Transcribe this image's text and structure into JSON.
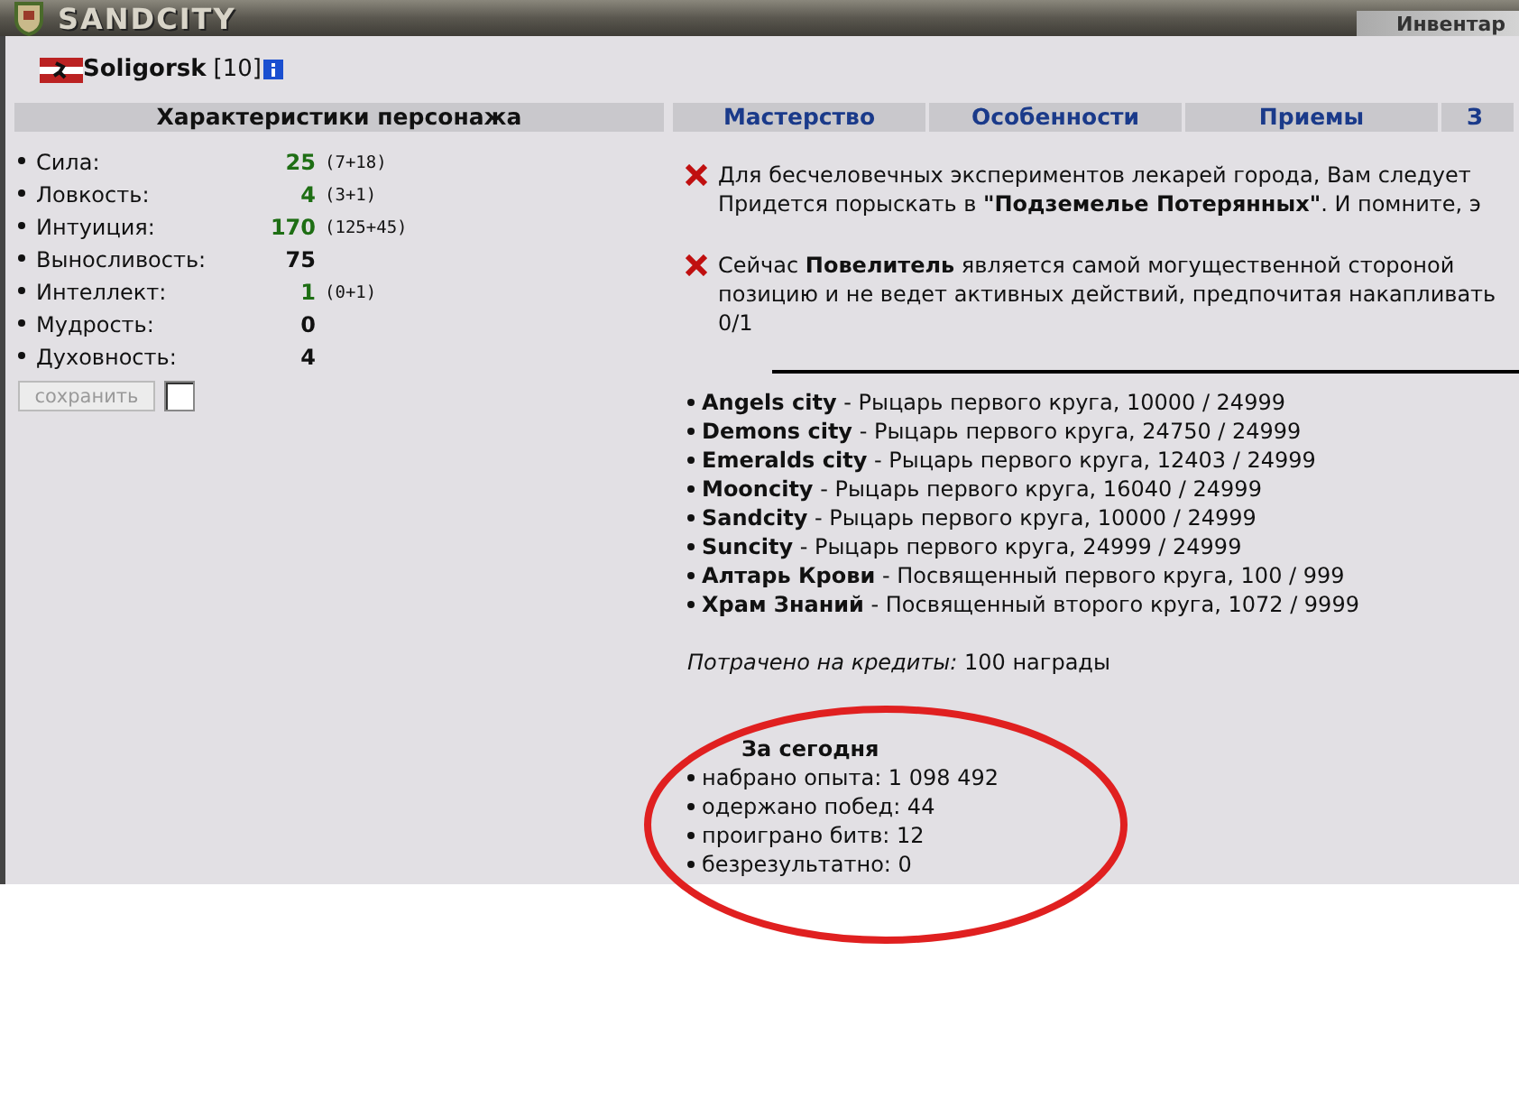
{
  "top_bar": {
    "logo": "SANDCITY",
    "button": "Инвентар"
  },
  "character": {
    "name": "Soligorsk",
    "level": "[10]"
  },
  "stats_panel": {
    "title": "Характеристики персонажа",
    "stats": [
      {
        "label": "Сила:",
        "value": "25",
        "bonus": "(7+18)",
        "boosted": true
      },
      {
        "label": "Ловкость:",
        "value": "4",
        "bonus": "(3+1)",
        "boosted": true
      },
      {
        "label": "Интуиция:",
        "value": "170",
        "bonus": "(125+45)",
        "boosted": true
      },
      {
        "label": "Выносливость:",
        "value": "75",
        "boosted": false
      },
      {
        "label": "Интеллект:",
        "value": "1",
        "bonus": "(0+1)",
        "boosted": true
      },
      {
        "label": "Мудрость:",
        "value": "0",
        "boosted": false
      },
      {
        "label": "Духовность:",
        "value": "4",
        "boosted": false
      }
    ],
    "save_button": {
      "label": "сохранить",
      "disabled": true
    },
    "checkbox": {
      "checked": false
    }
  },
  "tabs": [
    {
      "label": "Мастерство",
      "selected": false
    },
    {
      "label": "Особенности",
      "selected": false
    },
    {
      "label": "Приемы",
      "selected": false
    },
    {
      "label": "З",
      "selected": false
    }
  ],
  "messages": [
    {
      "lines": [
        "Для бесчеловечных экспериментов лекарей города, Вам следует",
        "Придется порыскать в **\"Подземелье Потерянных\"**. И помните, э"
      ]
    },
    {
      "lines": [
        "Сейчас **Повелитель** является самой могущественной стороной",
        "позицию и не ведет активных действий, предпочитая накапливать",
        "0/1"
      ]
    }
  ],
  "reputation": [
    {
      "place": "Angels city",
      "text": " - Рыцарь первого круга, 10000 / 24999"
    },
    {
      "place": "Demons city",
      "text": " - Рыцарь первого круга, 24750 / 24999"
    },
    {
      "place": "Emeralds city",
      "text": " - Рыцарь первого круга, 12403 / 24999"
    },
    {
      "place": "Mooncity",
      "text": " - Рыцарь первого круга, 16040 / 24999"
    },
    {
      "place": "Sandcity",
      "text": " - Рыцарь первого круга, 10000 / 24999"
    },
    {
      "place": "Suncity",
      "text": " - Рыцарь первого круга, 24999 / 24999"
    },
    {
      "place": "Алтарь Крови",
      "text": " - Посвященный первого круга, 100 / 999"
    },
    {
      "place": "Храм Знаний",
      "text": " - Посвященный второго круга, 1072 / 9999"
    }
  ],
  "spent": "*Потрачено на кредиты:* 100 награды",
  "today": {
    "title": "За сегодня",
    "items": [
      "набрано опыта: 1 098 492",
      "одержано побед: 44",
      "проиграно битв: 12",
      "безрезультатно: 0"
    ]
  }
}
